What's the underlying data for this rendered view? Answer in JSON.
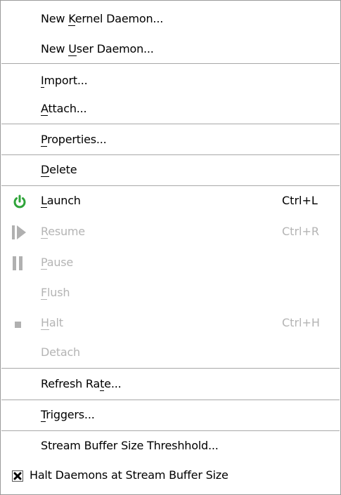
{
  "menu": {
    "items": [
      {
        "label": "New Kernel Daemon...",
        "mnemonic_index": 4
      },
      {
        "label": "New User Daemon...",
        "mnemonic_index": 4
      },
      {
        "label": "Import...",
        "mnemonic_index": 0
      },
      {
        "label": "Attach...",
        "mnemonic_index": 0
      },
      {
        "label": "Properties...",
        "mnemonic_index": 0
      },
      {
        "label": "Delete",
        "mnemonic_index": 0
      },
      {
        "label": "Launch",
        "shortcut": "Ctrl+L",
        "mnemonic_index": 0,
        "icon": "power-icon",
        "icon_color": "#2fa43a",
        "enabled": true
      },
      {
        "label": "Resume",
        "shortcut": "Ctrl+R",
        "mnemonic_index": 0,
        "icon": "resume-icon",
        "enabled": false
      },
      {
        "label": "Pause",
        "mnemonic_index": 0,
        "icon": "pause-icon",
        "enabled": false
      },
      {
        "label": "Flush",
        "mnemonic_index": 0,
        "enabled": false
      },
      {
        "label": "Halt",
        "shortcut": "Ctrl+H",
        "mnemonic_index": 0,
        "icon": "stop-icon",
        "enabled": false
      },
      {
        "label": "Detach",
        "enabled": false
      },
      {
        "label": "Refresh Rate...",
        "mnemonic_index": 10
      },
      {
        "label": "Triggers...",
        "mnemonic_index": 0
      },
      {
        "label": "Stream Buffer Size Threshhold..."
      },
      {
        "label": "Halt Daemons at Stream Buffer Size",
        "checked": true
      }
    ]
  },
  "colors": {
    "disabled_text": "#b4b4b4",
    "disabled_icon": "#b0b0b0",
    "launch_icon": "#2fa43a"
  }
}
